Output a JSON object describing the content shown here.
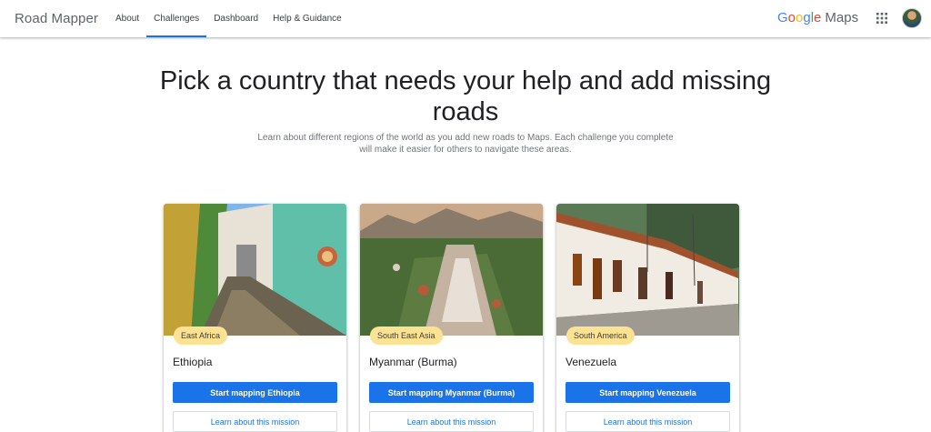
{
  "header": {
    "brand": "Road Mapper",
    "nav": [
      {
        "label": "About",
        "active": false
      },
      {
        "label": "Challenges",
        "active": true
      },
      {
        "label": "Dashboard",
        "active": false
      },
      {
        "label": "Help & Guidance",
        "active": false
      }
    ],
    "logo": {
      "google": "Google",
      "maps": "Maps"
    }
  },
  "hero": {
    "title_line1": "Pick a country that needs your help and add missing",
    "title_line2": "roads",
    "subtitle": "Learn about different regions of the world as you add new roads to Maps. Each challenge you complete will make it easier for others to navigate these areas."
  },
  "cards": [
    {
      "region": "East Africa",
      "country": "Ethiopia",
      "primary": "Start mapping Ethiopia",
      "secondary": "Learn about this mission"
    },
    {
      "region": "South East Asia",
      "country": "Myanmar (Burma)",
      "primary": "Start mapping Myanmar (Burma)",
      "secondary": "Learn about this mission"
    },
    {
      "region": "South America",
      "country": "Venezuela",
      "primary": "Start mapping Venezuela",
      "secondary": "Learn about this mission"
    }
  ],
  "colors": {
    "accent": "#1a73e8",
    "badge": "#fde293"
  }
}
